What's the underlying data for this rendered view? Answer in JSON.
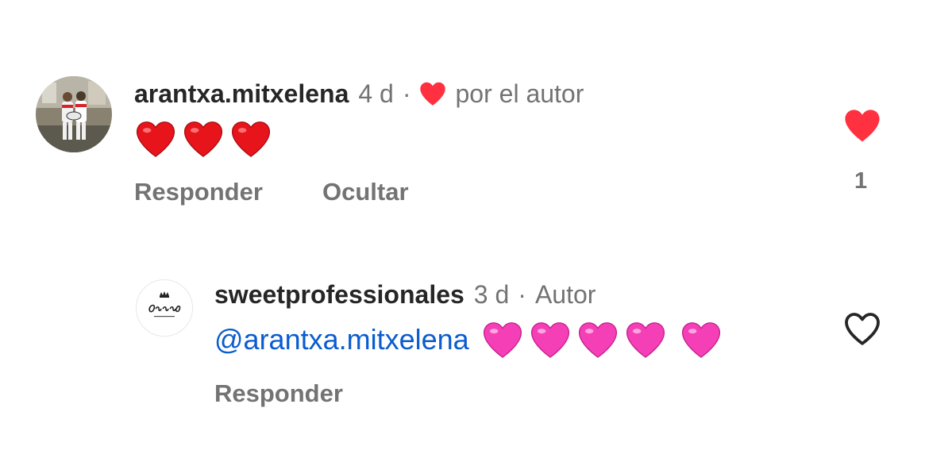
{
  "comments": [
    {
      "username": "arantxa.mitxelena",
      "age": "4 d",
      "separator": "·",
      "liked_by_author_label": "por el autor",
      "emoji_icons": [
        "red-heart-emoji",
        "red-heart-emoji",
        "red-heart-emoji"
      ],
      "actions": {
        "reply_label": "Responder",
        "hide_label": "Ocultar"
      },
      "like": {
        "icon": "heart-filled-icon",
        "liked": true,
        "count": "1",
        "color": "#ff3040"
      }
    },
    {
      "username": "sweetprofessionales",
      "age": "3 d",
      "separator": "·",
      "author_badge": "Autor",
      "mention": "@arantxa.mitxelena",
      "emoji_icons": [
        "pink-heart-emoji",
        "pink-heart-emoji",
        "pink-heart-emoji",
        "pink-heart-emoji",
        "pink-heart-emoji"
      ],
      "actions": {
        "reply_label": "Responder"
      },
      "like": {
        "icon": "heart-outline-icon",
        "liked": false
      }
    }
  ],
  "colors": {
    "text_primary": "#262626",
    "text_secondary": "#737373",
    "mention": "#0a5ccf",
    "like_red": "#ff3040",
    "pink_heart": "#f43fb6"
  }
}
